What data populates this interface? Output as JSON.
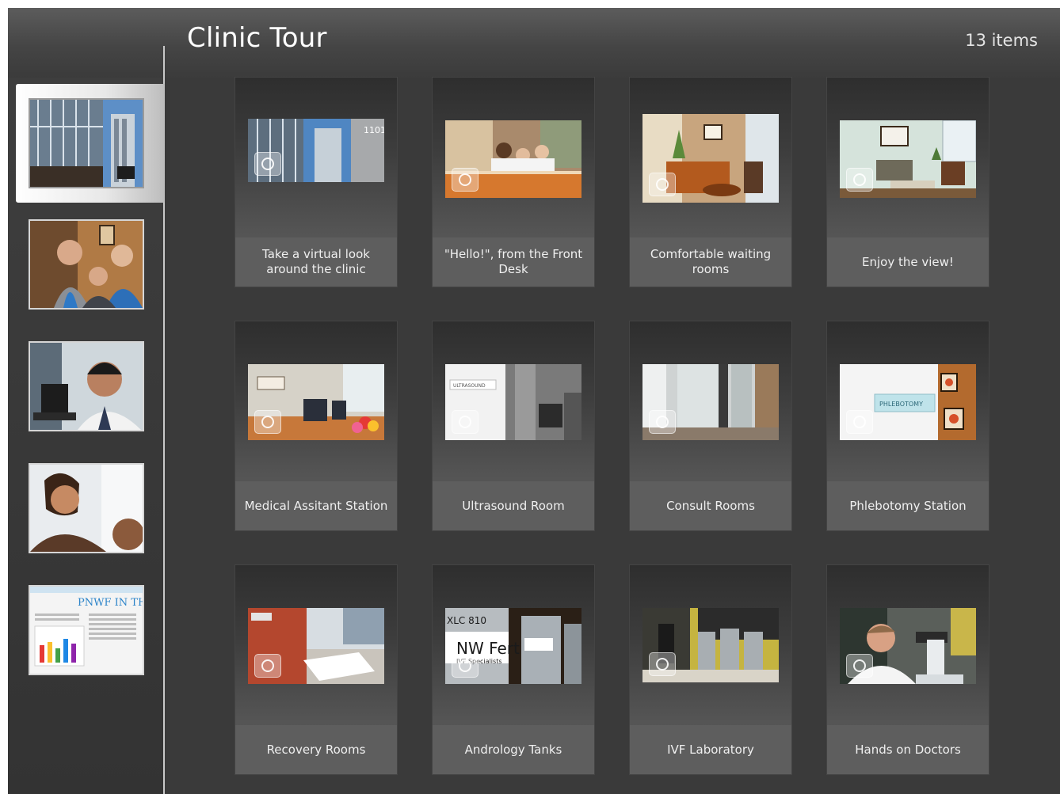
{
  "header": {
    "title": "Clinic Tour",
    "item_count": "13 items"
  },
  "sidebar": {
    "thumbnails": [
      {
        "name": "sidebar-thumb-building",
        "selected": true
      },
      {
        "name": "sidebar-thumb-staff",
        "selected": false
      },
      {
        "name": "sidebar-thumb-doctor",
        "selected": false
      },
      {
        "name": "sidebar-thumb-patient",
        "selected": false
      },
      {
        "name": "sidebar-thumb-newsletter",
        "selected": false,
        "newsletter_text": "PNWF IN THE"
      }
    ]
  },
  "gallery": {
    "items": [
      {
        "label": "Take a virtual look around the clinic",
        "icon": "camera-icon"
      },
      {
        "label": "\"Hello!\", from the Front Desk",
        "icon": "camera-icon"
      },
      {
        "label": "Comfortable waiting rooms",
        "icon": "camera-icon"
      },
      {
        "label": "Enjoy the view!",
        "icon": "camera-icon"
      },
      {
        "label": "Medical Assitant Station",
        "icon": "camera-icon"
      },
      {
        "label": "Ultrasound Room",
        "icon": "camera-icon"
      },
      {
        "label": "Consult Rooms",
        "icon": "camera-icon"
      },
      {
        "label": "Phlebotomy Station",
        "icon": "camera-icon"
      },
      {
        "label": "Recovery Rooms",
        "icon": "camera-icon"
      },
      {
        "label": "Andrology Tanks",
        "icon": "camera-icon"
      },
      {
        "label": "IVF Laboratory",
        "icon": "camera-icon"
      },
      {
        "label": "Hands on Doctors",
        "icon": "camera-icon"
      }
    ]
  },
  "photo_text": {
    "building_sign": "1101",
    "ultrasound_sign": "ULTRASOUND",
    "tank_label": "XLC 810",
    "tank_brand": "NW Fertil",
    "tank_sub": "IVF Specialists",
    "phlebotomy_sign": "PHLEBOTOMY"
  }
}
